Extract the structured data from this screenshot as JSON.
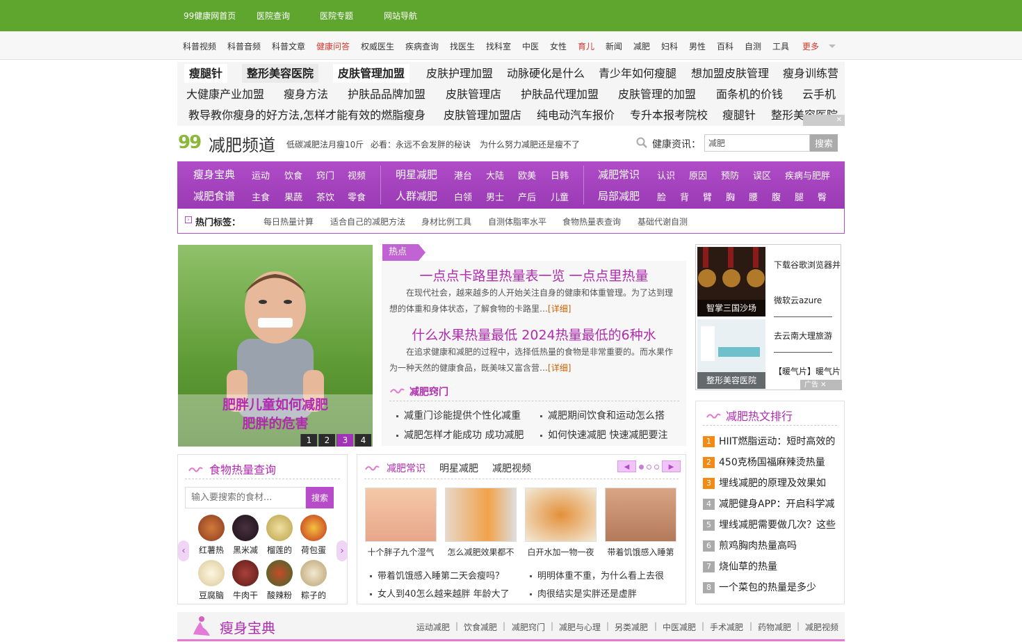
{
  "topbar": {
    "items": [
      "99健康网首页",
      "医院查询",
      "医院专题",
      "网站导航"
    ]
  },
  "subnav": {
    "items": [
      "科普视频",
      "科普音频",
      "科普文章",
      "健康问答",
      "权威医生",
      "疾病查询",
      "找医生",
      "找科室",
      "中医",
      "女性",
      "育儿",
      "新闻",
      "减肥",
      "妇科",
      "男性",
      "百科",
      "自测",
      "工具",
      "更多"
    ]
  },
  "keywords": {
    "row1": [
      "瘦腿针",
      "整形美容医院",
      "皮肤管理加盟",
      "皮肤护理加盟",
      "动脉硬化是什么",
      "青少年如何瘦腿",
      "想加盟皮肤管理",
      "瘦身训练营"
    ],
    "row2": [
      "大健康产业加盟",
      "瘦身方法",
      "护肤品品牌加盟",
      "皮肤管理店",
      "护肤品代理加盟",
      "皮肤管理的加盟",
      "面条机的价钱",
      "云手机"
    ],
    "row3": [
      "教导教你瘦身的好方法,怎样才能有效的燃脂瘦身",
      "皮肤管理加盟店",
      "纯电动汽车报价",
      "专升本报考院校",
      "瘦腿针",
      "整形美容医院"
    ]
  },
  "logo": {
    "num": "99",
    "text": "减肥频道"
  },
  "header_links": [
    "低碳减肥法月瘦10斤",
    "必看：永远不会发胖的秘诀",
    "为什么努力减肥还是瘦不了"
  ],
  "search": {
    "label": "健康资讯：",
    "value": "减肥",
    "button": "搜索"
  },
  "pnav": {
    "g1": {
      "h1": "瘦身宝典",
      "s1": [
        "运动",
        "饮食",
        "窍门",
        "视频"
      ],
      "h2": "减肥食谱",
      "s2": [
        "主食",
        "果蔬",
        "茶饮",
        "零食"
      ]
    },
    "g2": {
      "h1": "明星减肥",
      "s1": [
        "港台",
        "大陆",
        "欧美",
        "日韩"
      ],
      "h2": "人群减肥",
      "s2": [
        "白领",
        "男士",
        "产后",
        "儿童"
      ]
    },
    "g3": {
      "h1": "减肥常识",
      "s1": [
        "认识",
        "原因",
        "预防",
        "误区",
        "疾病与肥胖"
      ],
      "h2": "局部减肥",
      "s2": [
        "脸",
        "背",
        "臂",
        "胸",
        "腰",
        "腹",
        "腿",
        "臀"
      ]
    }
  },
  "tags": {
    "label": "热门标签：",
    "items": [
      "每日热量计算",
      "适合自己的减肥方法",
      "身材比例工具",
      "自测体脂率水平",
      "食物热量表查询",
      "基础代谢自测"
    ]
  },
  "slider": {
    "caption1": "肥胖儿童如何减肥",
    "caption2": "肥胖的危害",
    "dots": [
      "1",
      "2",
      "3",
      "4"
    ]
  },
  "hot": {
    "tag": "热点",
    "items": [
      {
        "title": "一点点卡路里热量表一览 一点点里热量",
        "desc": "在现代社会，越来越多的人开始关注自身的健康和体重管理。为了达到理想的体重和身体状态，了解食物的卡路里…",
        "more": "[详细]"
      },
      {
        "title": "什么水果热量最低 2024热量最低的6种水",
        "desc": "在追求健康和减肥的过程中，选择低热量的食物是非常重要的。而水果作为一种天然的健康食品，既美味又富含营…",
        "more": "[详细]"
      }
    ],
    "section_title": "减肥窍门",
    "section_items": [
      "减重门诊能提供个性化减重",
      "减肥期间饮食和运动怎么搭",
      "减肥怎样才能成功 成功减肥",
      "如何快速减肥 快速减肥要注"
    ]
  },
  "right_ad": {
    "thumb1": "智掌三国沙场",
    "thumb2": "整形美容医院",
    "texts": [
      "下载谷歌浏览器并",
      "微软云azure",
      "去云南大理旅游",
      "【暖气片】暖气片"
    ],
    "tag": "广告"
  },
  "rank": {
    "title": "减肥热文排行",
    "items": [
      "HIIT燃脂运动：短时高效的",
      "450克杨国福麻辣烫热量",
      "埋线减肥的原理及效果如",
      "减肥健身APP：开启科学减",
      "埋线减肥需要做几次？这些",
      "煎鸡胸肉热量高吗",
      "烧仙草的热量",
      "一个菜包的热量是多少"
    ],
    "nums": [
      "1",
      "2",
      "3",
      "4",
      "5",
      "6",
      "7",
      "8"
    ]
  },
  "food": {
    "title": "食物热量查询",
    "placeholder": "输入要搜索的食材...",
    "button": "搜索",
    "items": [
      "红薯热",
      "黑米减",
      "榴莲的",
      "荷包蛋",
      "豆腐脑",
      "牛肉干",
      "酸辣粉",
      "粽子的"
    ]
  },
  "know": {
    "tabs": [
      "减肥常识",
      "明星减肥",
      "减肥视频"
    ],
    "captions": [
      "十个胖子九个湿气",
      "怎么减肥效果都不",
      "白开水加一物一夜",
      "带着饥饿感入睡第"
    ],
    "list": [
      "带着饥饿感入睡第二天会瘦吗？",
      "明明体重不重，为什么看上去很",
      "女人到40怎么越来越胖 年龄大了",
      "肉很结实是实胖还是虚胖"
    ]
  },
  "bottom": {
    "title": "瘦身宝典",
    "links": [
      "运动减肥",
      "饮食减肥",
      "减肥窍门",
      "减肥与心理",
      "另类减肥",
      "中医减肥",
      "手术减肥",
      "药物减肥",
      "减肥视频"
    ]
  }
}
